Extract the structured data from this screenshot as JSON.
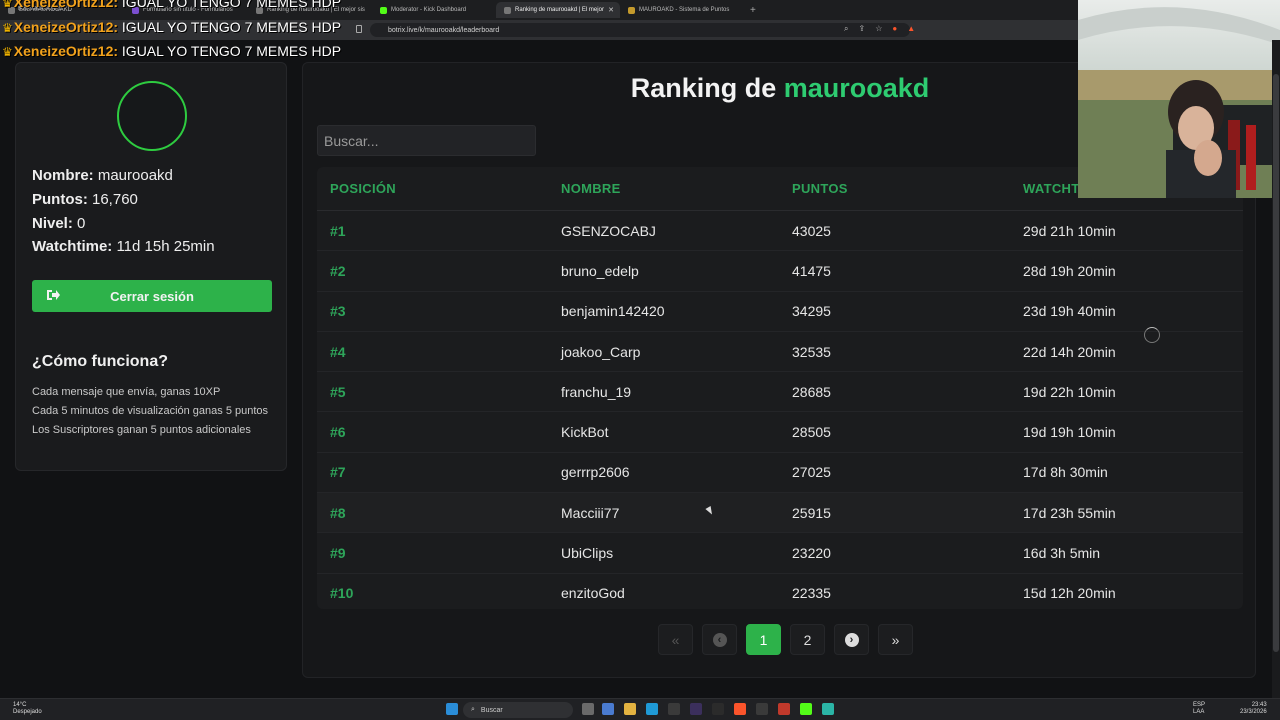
{
  "browser": {
    "tabs": [
      {
        "label": "Bots MAUROOAKD",
        "active": false
      },
      {
        "label": "Formulario sin título - Formularios",
        "active": false
      },
      {
        "label": "Ranking de maurooakd | El mejor sis",
        "active": false
      },
      {
        "label": "Moderator - Kick Dashboard",
        "active": false
      },
      {
        "label": "Ranking de maurooakd | El mejor",
        "active": true
      },
      {
        "label": "MAUROAKD - Sistema de Puntos",
        "active": false
      }
    ],
    "new_tab": "+",
    "url": "botrix.live/k/maurooakd/leaderboard"
  },
  "chat_overlay": {
    "lines": [
      {
        "user": "XeneizeOrtiz12:",
        "message": "IGUAL YO TENGO 7 MEMES HDP"
      },
      {
        "user": "XeneizeOrtiz12:",
        "message": "IGUAL YO TENGO 7 MEMES HDP"
      },
      {
        "user": "XeneizeOrtiz12:",
        "message": "IGUAL YO TENGO 7 MEMES HDP"
      }
    ]
  },
  "profile": {
    "name_label": "Nombre:",
    "name_value": "maurooakd",
    "points_label": "Puntos:",
    "points_value": "16,760",
    "level_label": "Nivel:",
    "level_value": "0",
    "watchtime_label": "Watchtime:",
    "watchtime_value": "11d 15h 25min",
    "logout_label": "Cerrar sesión",
    "how_title": "¿Cómo funciona?",
    "how_lines": [
      "Cada mensaje que envía, ganas 10XP",
      "Cada 5 minutos de visualización ganas 5 puntos",
      "Los Suscriptores ganan 5 puntos adicionales"
    ]
  },
  "leaderboard": {
    "title_prefix": "Ranking de",
    "title_user": "maurooakd",
    "search_placeholder": "Buscar...",
    "columns": [
      "POSICIÓN",
      "NOMBRE",
      "PUNTOS",
      "WATCHTIME"
    ],
    "rows": [
      {
        "pos": "#1",
        "name": "GSENZOCABJ",
        "points": "43025",
        "watch": "29d 21h 10min"
      },
      {
        "pos": "#2",
        "name": "bruno_edelp",
        "points": "41475",
        "watch": "28d 19h 20min"
      },
      {
        "pos": "#3",
        "name": "benjamin142420",
        "points": "34295",
        "watch": "23d 19h 40min"
      },
      {
        "pos": "#4",
        "name": "joakoo_Carp",
        "points": "32535",
        "watch": "22d 14h 20min"
      },
      {
        "pos": "#5",
        "name": "franchu_19",
        "points": "28685",
        "watch": "19d 22h 10min"
      },
      {
        "pos": "#6",
        "name": "KickBot",
        "points": "28505",
        "watch": "19d 19h 10min"
      },
      {
        "pos": "#7",
        "name": "gerrrp2606",
        "points": "27025",
        "watch": "17d 8h 30min"
      },
      {
        "pos": "#8",
        "name": "Macciii77",
        "points": "25915",
        "watch": "17d 23h 55min"
      },
      {
        "pos": "#9",
        "name": "UbiClips",
        "points": "23220",
        "watch": "16d 3h 5min"
      },
      {
        "pos": "#10",
        "name": "enzitoGod",
        "points": "22335",
        "watch": "15d 12h 20min"
      }
    ],
    "pagination": {
      "first": "«",
      "prev": "‹",
      "pages": [
        "1",
        "2"
      ],
      "current": "1",
      "next": "›",
      "last": "»"
    }
  },
  "taskbar": {
    "temp": "14°C",
    "weather": "Despejado",
    "search": "Buscar",
    "lang1": "ESP",
    "lang2": "LAA",
    "time": "23:43",
    "date": "23/3/2026"
  },
  "colors": {
    "accent": "#2ecc71",
    "button": "#2db24a",
    "background": "#111214"
  }
}
